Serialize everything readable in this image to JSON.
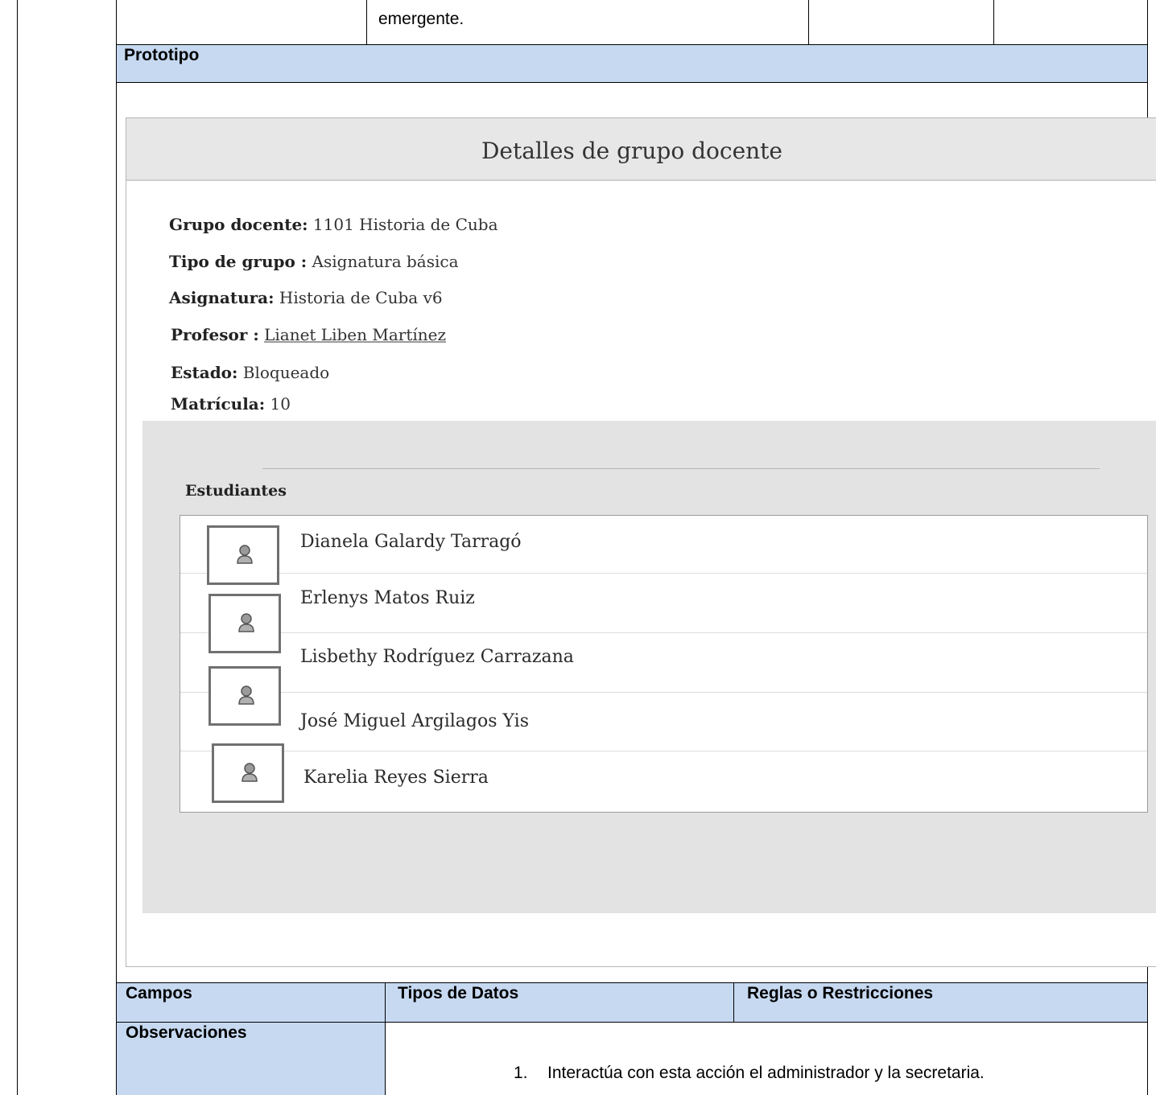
{
  "top_row": {
    "cell_text": "emergente."
  },
  "prototipo_header": "Prototipo",
  "prototype": {
    "title": "Detalles de grupo docente",
    "fields": [
      {
        "label": "Grupo docente:",
        "value": "1101 Historia de Cuba"
      },
      {
        "label": "Tipo de grupo :",
        "value": "Asignatura básica"
      },
      {
        "label": "Asignatura:",
        "value": "Historia de Cuba v6"
      },
      {
        "label": "Profesor :",
        "value": "Lianet Liben Martínez"
      },
      {
        "label": "Estado:",
        "value": "Bloqueado"
      },
      {
        "label": "Matrícula:",
        "value": "10"
      }
    ],
    "students_title": "Estudiantes",
    "students": [
      "Dianela Galardy Tarragó",
      "Erlenys Matos Ruiz",
      "Lisbethy Rodríguez Carrazana",
      "José Miguel Argilagos Yis",
      "Karelia Reyes Sierra"
    ]
  },
  "table_headers": {
    "campos": "Campos",
    "tipos": "Tipos de Datos",
    "reglas": "Reglas o Restricciones"
  },
  "observaciones": {
    "label": "Observaciones",
    "item_number": "1.",
    "item_text": "Interactúa con esta acción el administrador y la secretaria."
  }
}
